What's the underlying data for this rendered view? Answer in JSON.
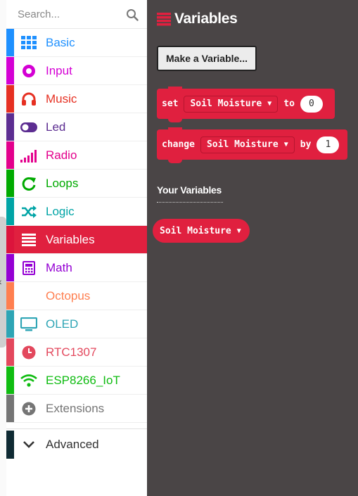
{
  "search": {
    "placeholder": "Search..."
  },
  "categories": [
    {
      "label": "Basic",
      "color": "#1e90ff",
      "icon": "grid-icon"
    },
    {
      "label": "Input",
      "color": "#d400d4",
      "icon": "target-icon"
    },
    {
      "label": "Music",
      "color": "#e63022",
      "icon": "headphones-icon"
    },
    {
      "label": "Led",
      "color": "#5c2d91",
      "icon": "toggle-icon"
    },
    {
      "label": "Radio",
      "color": "#e3008c",
      "icon": "signal-bars-icon"
    },
    {
      "label": "Loops",
      "color": "#00aa00",
      "icon": "loop-arrow-icon"
    },
    {
      "label": "Logic",
      "color": "#00a4a6",
      "icon": "shuffle-icon"
    },
    {
      "label": "Variables",
      "color": "#dc143c",
      "icon": "list-icon"
    },
    {
      "label": "Math",
      "color": "#9400d3",
      "icon": "calculator-icon"
    },
    {
      "label": "Octopus",
      "color": "#ff7f50",
      "icon": "blank-icon"
    },
    {
      "label": "OLED",
      "color": "#2ea5b5",
      "icon": "monitor-icon"
    },
    {
      "label": "RTC1307",
      "color": "#e3485d",
      "icon": "clock-icon"
    },
    {
      "label": "ESP8266_IoT",
      "color": "#0fbc11",
      "icon": "wifi-icon"
    },
    {
      "label": "Extensions",
      "color": "#757575",
      "icon": "plus-circle-icon"
    }
  ],
  "advanced": {
    "label": "Advanced"
  },
  "flyout": {
    "title": "Variables",
    "make_variable_button": "Make a Variable...",
    "set_block": {
      "keyword": "set",
      "variable": "Soil Moisture",
      "to": "to",
      "value": "0"
    },
    "change_block": {
      "keyword": "change",
      "variable": "Soil Moisture",
      "by": "by",
      "value": "1"
    },
    "your_variables_heading": "Your Variables",
    "variables": [
      "Soil Moisture"
    ]
  },
  "colors": {
    "variables_block": "#e0203f",
    "flyout_bg": "#4a4546"
  }
}
